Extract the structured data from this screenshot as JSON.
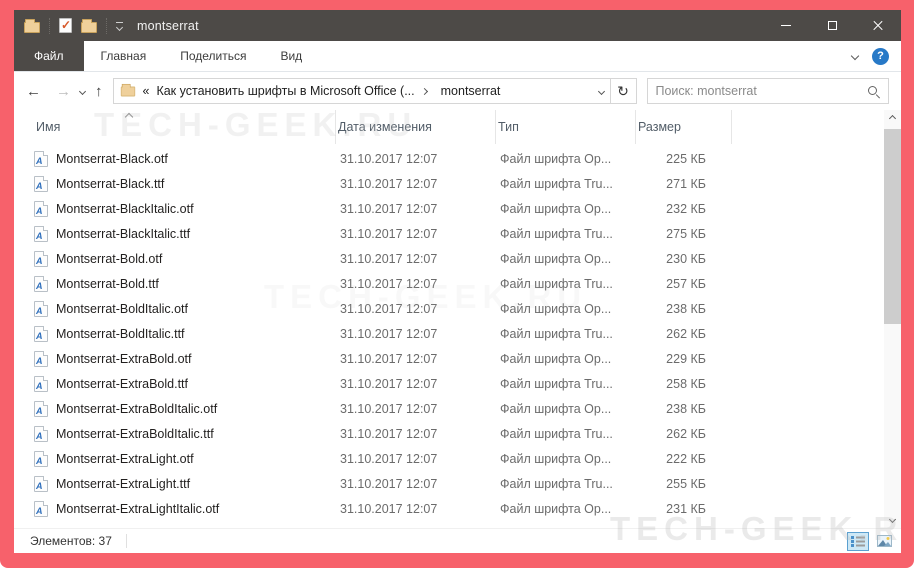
{
  "titlebar": {
    "title": "montserrat"
  },
  "ribbon": {
    "tabs": [
      {
        "label": "Файл"
      },
      {
        "label": "Главная"
      },
      {
        "label": "Поделиться"
      },
      {
        "label": "Вид"
      }
    ],
    "help_label": "?"
  },
  "address_bar": {
    "back_glyph": "←",
    "forward_glyph": "→",
    "up_glyph": "↑",
    "refresh_glyph": "↻",
    "crumb_truncation": "«",
    "crumb_parent": "Как установить шрифты в Microsoft Office (...",
    "crumb_current": "montserrat",
    "search_placeholder": "Поиск: montserrat"
  },
  "list": {
    "columns": [
      "Имя",
      "Дата изменения",
      "Тип",
      "Размер"
    ],
    "rows": [
      {
        "name": "Montserrat-Black.otf",
        "date": "31.10.2017 12:07",
        "type": "Файл шрифта Op...",
        "size": "225 КБ"
      },
      {
        "name": "Montserrat-Black.ttf",
        "date": "31.10.2017 12:07",
        "type": "Файл шрифта Tru...",
        "size": "271 КБ"
      },
      {
        "name": "Montserrat-BlackItalic.otf",
        "date": "31.10.2017 12:07",
        "type": "Файл шрифта Op...",
        "size": "232 КБ"
      },
      {
        "name": "Montserrat-BlackItalic.ttf",
        "date": "31.10.2017 12:07",
        "type": "Файл шрифта Tru...",
        "size": "275 КБ"
      },
      {
        "name": "Montserrat-Bold.otf",
        "date": "31.10.2017 12:07",
        "type": "Файл шрифта Op...",
        "size": "230 КБ"
      },
      {
        "name": "Montserrat-Bold.ttf",
        "date": "31.10.2017 12:07",
        "type": "Файл шрифта Tru...",
        "size": "257 КБ"
      },
      {
        "name": "Montserrat-BoldItalic.otf",
        "date": "31.10.2017 12:07",
        "type": "Файл шрифта Op...",
        "size": "238 КБ"
      },
      {
        "name": "Montserrat-BoldItalic.ttf",
        "date": "31.10.2017 12:07",
        "type": "Файл шрифта Tru...",
        "size": "262 КБ"
      },
      {
        "name": "Montserrat-ExtraBold.otf",
        "date": "31.10.2017 12:07",
        "type": "Файл шрифта Op...",
        "size": "229 КБ"
      },
      {
        "name": "Montserrat-ExtraBold.ttf",
        "date": "31.10.2017 12:07",
        "type": "Файл шрифта Tru...",
        "size": "258 КБ"
      },
      {
        "name": "Montserrat-ExtraBoldItalic.otf",
        "date": "31.10.2017 12:07",
        "type": "Файл шрифта Op...",
        "size": "238 КБ"
      },
      {
        "name": "Montserrat-ExtraBoldItalic.ttf",
        "date": "31.10.2017 12:07",
        "type": "Файл шрифта Tru...",
        "size": "262 КБ"
      },
      {
        "name": "Montserrat-ExtraLight.otf",
        "date": "31.10.2017 12:07",
        "type": "Файл шрифта Op...",
        "size": "222 КБ"
      },
      {
        "name": "Montserrat-ExtraLight.ttf",
        "date": "31.10.2017 12:07",
        "type": "Файл шрифта Tru...",
        "size": "255 КБ"
      },
      {
        "name": "Montserrat-ExtraLightItalic.otf",
        "date": "31.10.2017 12:07",
        "type": "Файл шрифта Op...",
        "size": "231 КБ"
      }
    ]
  },
  "status_bar": {
    "items_count": "Элементов: 37"
  },
  "watermark": {
    "text": "TECH-GEEK.RU"
  },
  "colors": {
    "frame_red": "#f7616b",
    "titlebar_dark": "#4d4a47",
    "help_blue": "#2779c7",
    "selected_view_bg": "#cde8f6",
    "selected_view_border": "#5ba0d0"
  }
}
